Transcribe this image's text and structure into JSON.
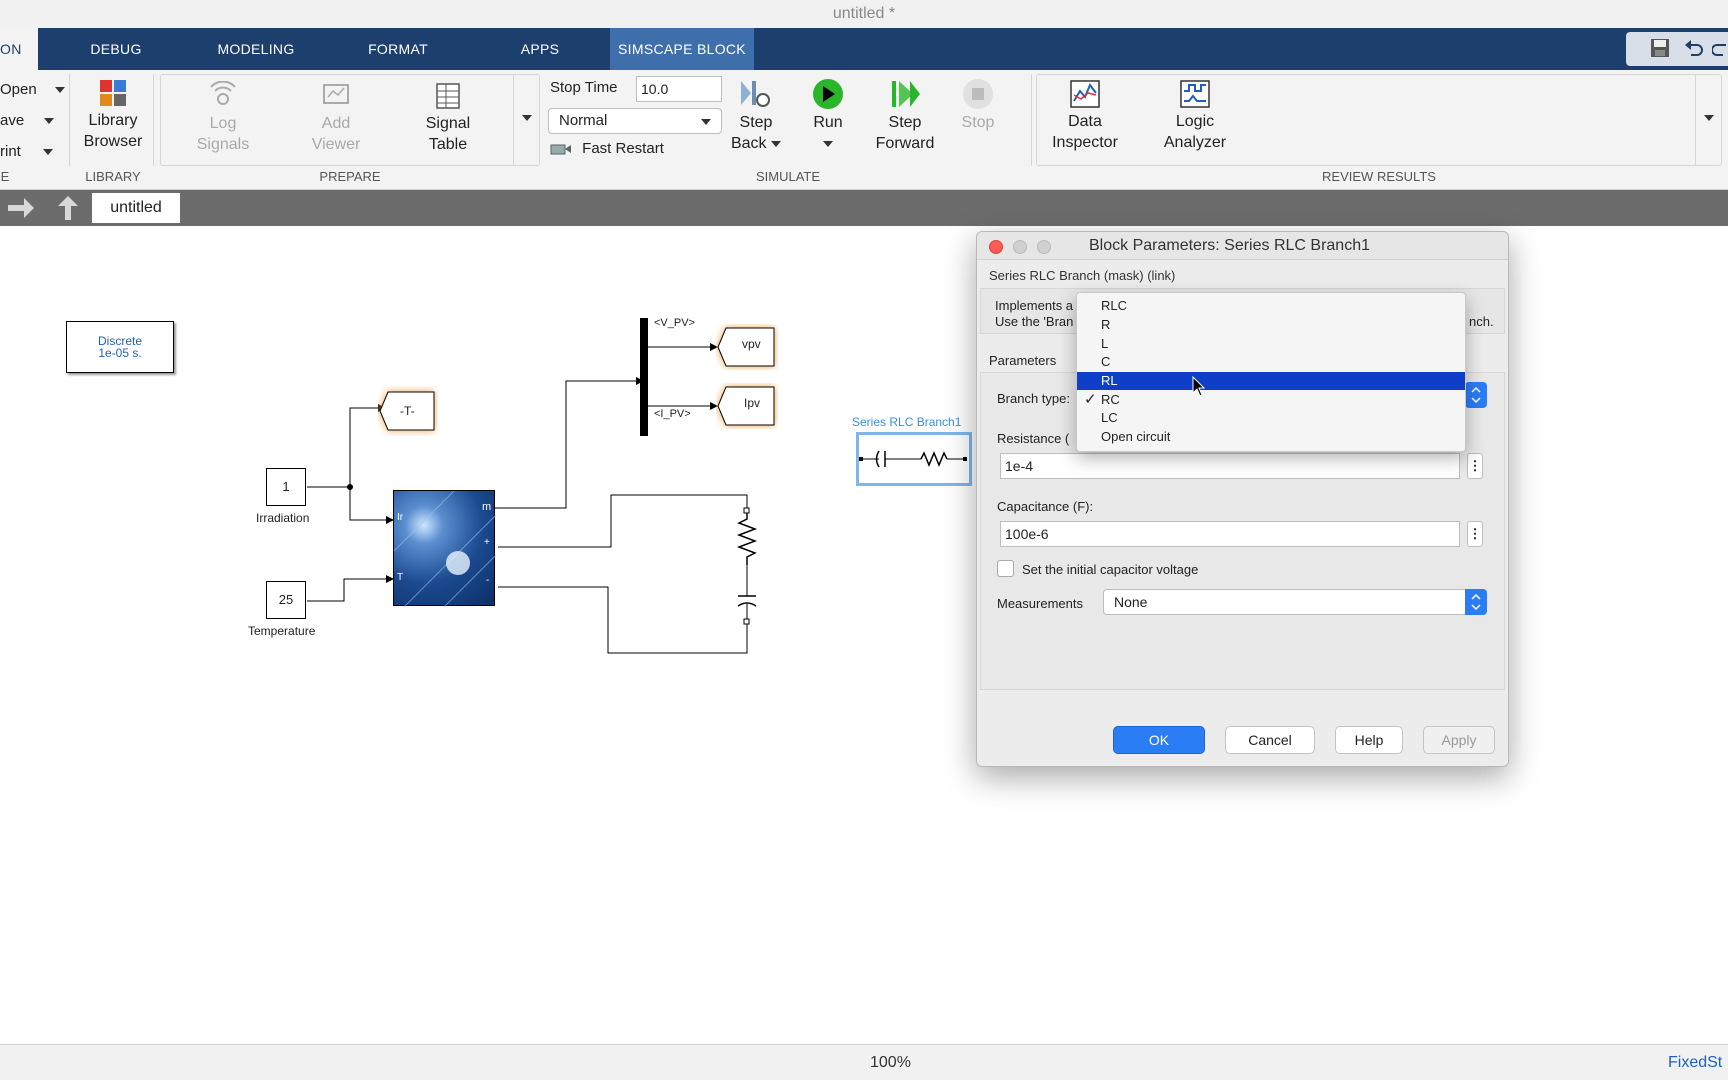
{
  "window": {
    "title": "untitled *"
  },
  "tabs": [
    {
      "label": "ON"
    },
    {
      "label": "DEBUG"
    },
    {
      "label": "MODELING"
    },
    {
      "label": "FORMAT"
    },
    {
      "label": "APPS"
    },
    {
      "label": "SIMSCAPE BLOCK"
    }
  ],
  "ribbon": {
    "file_items": [
      "Open",
      "ave",
      "rint"
    ],
    "library": {
      "btn_line1": "Library",
      "btn_line2": "Browser",
      "section": "LIBRARY"
    },
    "prepare": {
      "log_line1": "Log",
      "log_line2": "Signals",
      "add_line1": "Add",
      "add_line2": "Viewer",
      "table_line1": "Signal",
      "table_line2": "Table",
      "section": "PREPARE"
    },
    "simulate": {
      "stop_time_label": "Stop Time",
      "stop_time_value": "10.0",
      "mode_value": "Normal",
      "fast_restart_label": "Fast Restart",
      "step_back_line1": "Step",
      "step_back_line2": "Back",
      "run_label": "Run",
      "step_fwd_line1": "Step",
      "step_fwd_line2": "Forward",
      "stop_label": "Stop",
      "section": "SIMULATE"
    },
    "review": {
      "data_line1": "Data",
      "data_line2": "Inspector",
      "logic_line1": "Logic",
      "logic_line2": "Analyzer",
      "section": "REVIEW RESULTS"
    }
  },
  "address": {
    "tab_label": "untitled"
  },
  "canvas": {
    "powergui_line1": "Discrete",
    "powergui_line2": "1e-05 s.",
    "goto_t": "-T-",
    "goto_vpv": "vpv",
    "goto_ipv": "Ipv",
    "bus_v": "<V_PV>",
    "bus_i": "<I_PV>",
    "irr_value": "1",
    "irr_label": "Irradiation",
    "temp_value": "25",
    "temp_label": "Temperature",
    "pv_port_ir": "Ir",
    "pv_port_t": "T",
    "pv_port_m": "m",
    "pv_port_plus": "+",
    "pv_port_minus": "-",
    "rlc_label": "Series RLC Branch1"
  },
  "dialog": {
    "title": "Block Parameters: Series RLC Branch1",
    "subtitle": "Series RLC Branch (mask) (link)",
    "desc_line1": "Implements a",
    "desc_line2_left": "Use the 'Bran",
    "desc_line2_right": "nch.",
    "params_header": "Parameters",
    "branch_type_label": "Branch type:",
    "resistance_label": "Resistance (",
    "resistance_value": "1e-4",
    "capacitance_label": "Capacitance (F):",
    "capacitance_value": "100e-6",
    "init_voltage_label": "Set the initial capacitor voltage",
    "measurements_label": "Measurements",
    "measurements_value": "None",
    "ok_label": "OK",
    "cancel_label": "Cancel",
    "help_label": "Help",
    "apply_label": "Apply"
  },
  "branch_menu": {
    "items": [
      "RLC",
      "R",
      "L",
      "C",
      "RL",
      "RC",
      "LC",
      "Open circuit"
    ],
    "highlighted": "RL",
    "checked": "RC"
  },
  "status": {
    "zoom": "100%",
    "solver": "FixedSt"
  },
  "colors": {
    "tab_bar": "#1c3f6e",
    "active_tab": "#3f6faa",
    "highlight": "#0f3fc8",
    "ok_button": "#2b7df6",
    "run_green": "#2bb52b"
  }
}
